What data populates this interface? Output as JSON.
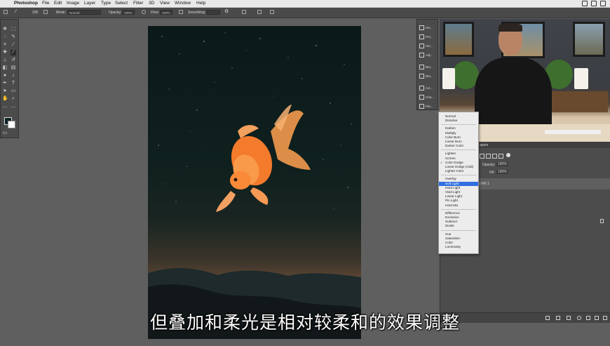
{
  "menubar": {
    "app_name": "Photoshop",
    "items": [
      "File",
      "Edit",
      "Image",
      "Layer",
      "Type",
      "Select",
      "Filter",
      "3D",
      "View",
      "Window",
      "Help"
    ]
  },
  "options_bar": {
    "brush_size": "200",
    "mode_label": "Mode:",
    "mode_value": "Normal",
    "opacity_label": "Opacity:",
    "opacity_value": "100%",
    "flow_label": "Flow:",
    "flow_value": "100%",
    "smoothing_label": "Smoothing:"
  },
  "blend_menu": {
    "groups": [
      [
        "Normal",
        "Dissolve"
      ],
      [
        "Darken",
        "Multiply",
        "Color Burn",
        "Linear Burn",
        "Darker Color"
      ],
      [
        "Lighten",
        "Screen",
        "Color Dodge",
        "Linear Dodge (Add)",
        "Lighter Color"
      ],
      [
        "Overlay",
        "Soft Light",
        "Hard Light",
        "Vivid Light",
        "Linear Light",
        "Pin Light",
        "Hard Mix"
      ],
      [
        "Difference",
        "Exclusion",
        "Subtract",
        "Divide"
      ],
      [
        "Hue",
        "Saturation",
        "Color",
        "Luminosity"
      ]
    ],
    "checked": "Color Dodge",
    "highlighted": "Soft Light"
  },
  "side_panel": {
    "items": [
      "His...",
      "Pro...",
      "His...",
      "Adj...",
      "Bru...",
      "Bru...",
      "Act...",
      "Cha...",
      "Par..."
    ]
  },
  "layers_panel": {
    "tab_partial": "ayers",
    "opacity_label": "Opacity:",
    "opacity_value": "100%",
    "fill_label": "Fill:",
    "fill_value": "100%",
    "selected_layer_partial": "r Fill 1"
  },
  "subtitle": "但叠加和柔光是相对较柔和的效果调整",
  "colors": {
    "ps_panel": "#4b4b4b",
    "ps_workspace": "#5f5f5f",
    "menu_highlight": "#2f6fe0",
    "foreground_swatch": "#0e2326",
    "background_swatch": "#ffffff"
  },
  "icons": [
    "apple-icon",
    "home-icon",
    "brush-icon",
    "airbrush-icon",
    "pressure-icon",
    "gear-icon",
    "symmetry-icon",
    "search-icon",
    "workspace-icon",
    "share-icon"
  ]
}
